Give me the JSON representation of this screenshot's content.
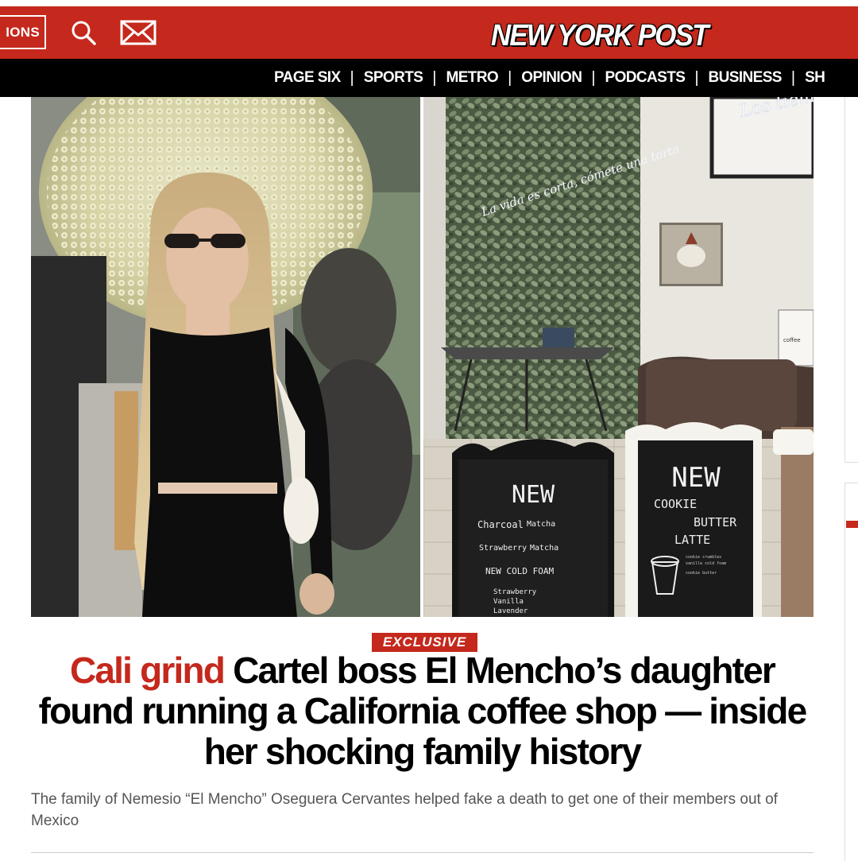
{
  "header": {
    "editions_label": "IONS",
    "search_icon": "search-icon",
    "mail_icon": "mail-icon",
    "logo": "NEW YORK POST",
    "brand_color": "#c5281c"
  },
  "nav": {
    "items": [
      "PAGE SIX",
      "SPORTS",
      "METRO",
      "OPINION",
      "PODCASTS",
      "BUSINESS",
      "SH"
    ]
  },
  "photo_signage": {
    "neon": "La vida es corta, cómete una torta",
    "wall_neon": "Los tiempos son per",
    "poster": "coffee",
    "board_left": {
      "title": "NEW",
      "line1_a": "Charcoal",
      "line1_b": "Matcha",
      "line2_a": "Strawberry",
      "line2_b": "Matcha",
      "section": "NEW COLD FOAM",
      "items": [
        "Strawberry",
        "Vanilla",
        "Lavender"
      ]
    },
    "board_right": {
      "title": "NEW",
      "line1": "COOKIE",
      "line2": "BUTTER",
      "line3": "LATTE",
      "small1": "cookie crumbles",
      "small2": "vanilla cold foam",
      "small3": "cookie butter"
    }
  },
  "article": {
    "badge": "EXCLUSIVE",
    "kicker": "Cali grind",
    "headline": "Cartel boss El Mencho’s daughter found running a California coffee shop — inside her shocking family history",
    "dek": "The family of Nemesio “El Mencho” Oseguera Cervantes helped fake a death to get one of their members out of Mexico"
  }
}
